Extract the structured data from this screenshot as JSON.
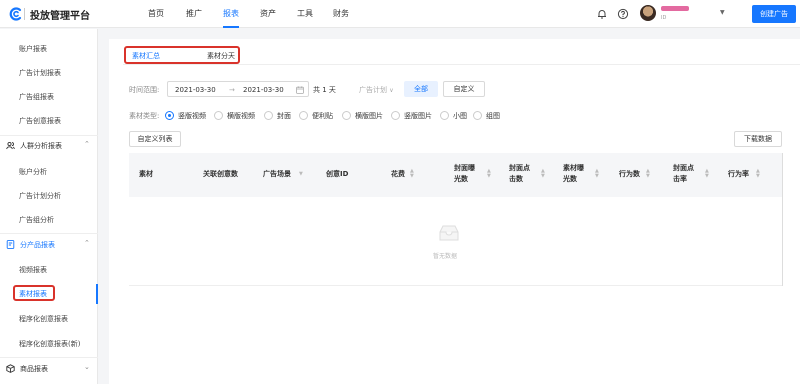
{
  "header": {
    "brand": "投放管理平台",
    "nav": [
      "首页",
      "推广",
      "报表",
      "资产",
      "工具",
      "财务"
    ],
    "active_nav": "报表",
    "user_id_prefix": "ID",
    "create_button": "创建广告",
    "accent_color": "#1677ff"
  },
  "sidebar": {
    "items_top": [
      "账户报表",
      "广告计划报表",
      "广告组报表",
      "广告创意报表"
    ],
    "group_audience": "人群分析报表",
    "audience_items": [
      "账户分析",
      "广告计划分析",
      "广告组分析"
    ],
    "group_product": "分产品报表",
    "product_items": [
      "视频报表",
      "素材报表",
      "程序化创意报表",
      "程序化创意报表(新)"
    ],
    "group_goods": "商品报表"
  },
  "tabs": [
    "素材汇总",
    "素材分天"
  ],
  "filters": {
    "time_label": "时间范围:",
    "start_date": "2021-03-30",
    "arrow": "→",
    "end_date": "2021-03-30",
    "duration": "共 1 天",
    "plan_label": "广告计划",
    "all_btn": "全部",
    "custom_btn": "自定义",
    "type_label": "素材类型:",
    "types": [
      "竖版视频",
      "横版视频",
      "封面",
      "便利贴",
      "横版图片",
      "竖版图片",
      "小图",
      "组图"
    ],
    "selected_type": "竖版视频"
  },
  "toolbar": {
    "custom_columns": "自定义列表",
    "download": "下载数据"
  },
  "table": {
    "col_material": "素材",
    "col_linked": "关联创意数",
    "col_scene": "广告场景",
    "col_creative_id": "创意ID",
    "col_cost": "花费",
    "col_cover_imp_1": "封面曝",
    "col_cover_imp_2": "光数",
    "col_cover_clk_1": "封面点",
    "col_cover_clk_2": "击数",
    "col_mat_imp_1": "素材曝",
    "col_mat_imp_2": "光数",
    "col_actions": "行为数",
    "col_cover_ctr_1": "封面点",
    "col_cover_ctr_2": "击率",
    "col_action_rate": "行为率",
    "empty": "暂无数据"
  }
}
